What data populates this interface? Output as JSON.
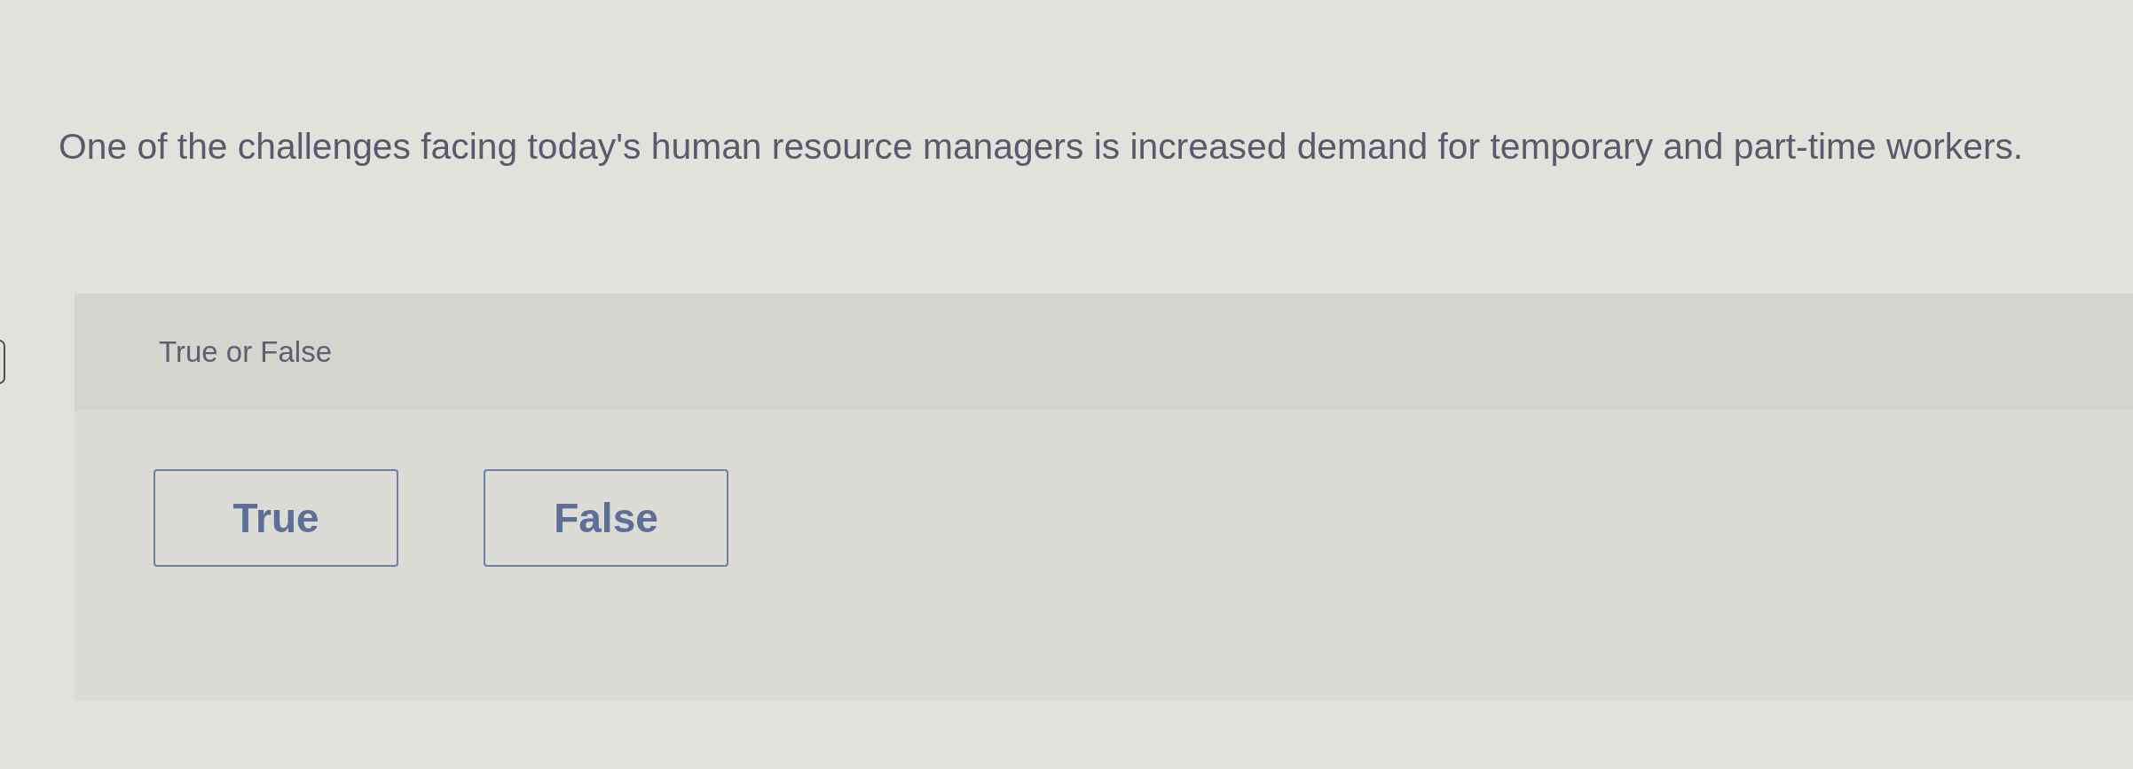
{
  "question": {
    "text": "One of the challenges facing today's human resource managers is increased demand for temporary and part-time workers."
  },
  "answer_panel": {
    "prompt": "True or False",
    "options": [
      {
        "label": "True",
        "selected": false
      },
      {
        "label": "False",
        "selected": false
      }
    ]
  }
}
